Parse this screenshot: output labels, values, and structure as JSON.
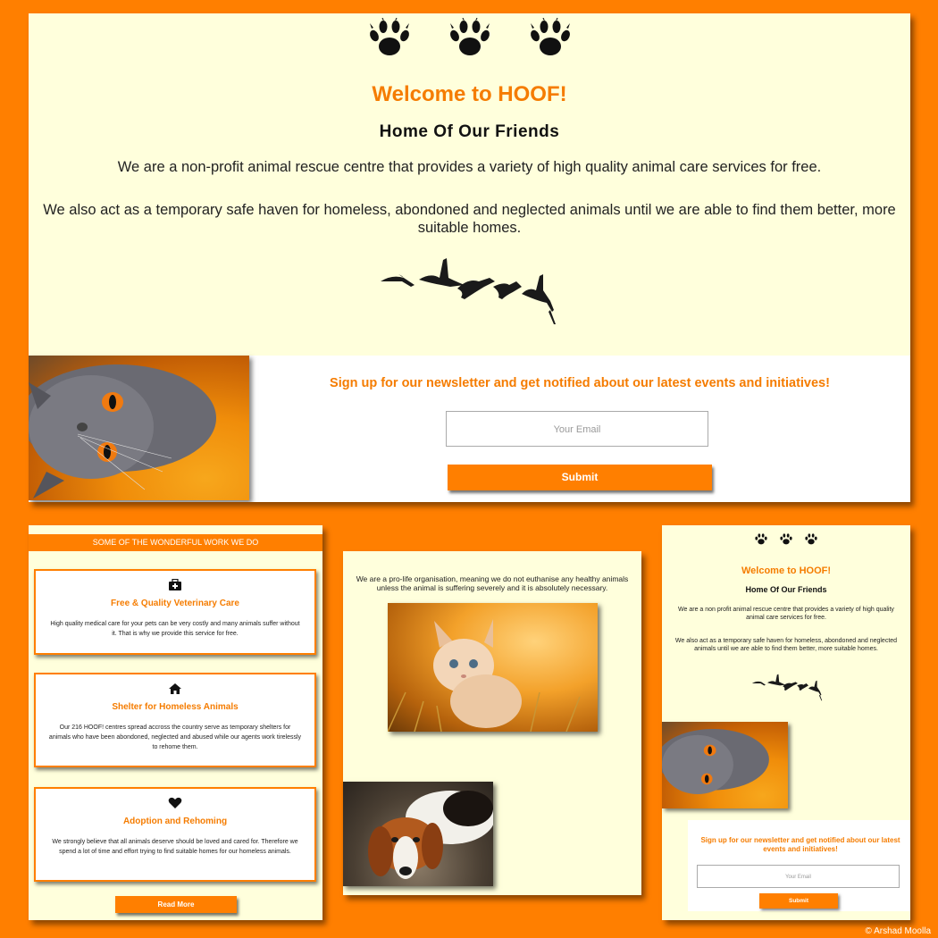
{
  "main": {
    "paw_icons": [
      "paw-icon",
      "paw-icon",
      "paw-icon"
    ],
    "title": "Welcome to HOOF!",
    "subtitle": "Home Of Our Friends",
    "paragraph1": "We are a non-profit animal rescue centre that provides a variety of high quality animal care services for free.",
    "paragraph2": "We also act as a temporary safe haven for homeless, abondoned and neglected animals until we are able to find them better, more suitable homes.",
    "newsletter_text": "Sign up for our newsletter and get notified about our latest events and initiatives!",
    "email_placeholder": "Your Email",
    "submit_label": "Submit"
  },
  "services": {
    "header": "SOME OF THE WONDERFUL WORK WE DO",
    "cards": [
      {
        "icon": "medical-kit-icon",
        "title": "Free & Quality Veterinary Care",
        "description": "High quality medical care for your pets can be very costly and many animals suffer without it. That is why we provide this service for free."
      },
      {
        "icon": "home-icon",
        "title": "Shelter for Homeless Animals",
        "description": "Our 216 HOOF! centres spread accross the country serve as temporary shelters for animals who have been abondoned, neglected and abused while our agents work tirelessly to rehome them."
      },
      {
        "icon": "heart-icon",
        "title": "Adoption and Rehoming",
        "description": "We strongly believe that all animals deserve should be loved and cared for. Therefore we spend a lot of time and effort trying to find suitable homes for our homeless animals."
      }
    ],
    "read_more_label": "Read More"
  },
  "gallery": {
    "text": "We are a pro-life organisation, meaning we do not euthanise any healthy animals unless the animal is suffering severely and it is absolutely necessary."
  },
  "mobile": {
    "title": "Welcome to HOOF!",
    "subtitle": "Home Of Our Friends",
    "paragraph1": "We are a non profit animal rescue centre that provides a variety of high quality animal care services for free.",
    "paragraph2": "We also act as a temporary safe haven for homeless, abondoned and neglected animals until we are able to find them better, more suitable homes.",
    "newsletter_text": "Sign up for our newsletter and get notified about our latest events and initiatives!",
    "email_placeholder": "Your Email",
    "submit_label": "Submit"
  },
  "credit": "© Arshad Moolla",
  "colors": {
    "accent": "#ff7f00",
    "panel": "#ffffdc",
    "title": "#f57c00"
  }
}
